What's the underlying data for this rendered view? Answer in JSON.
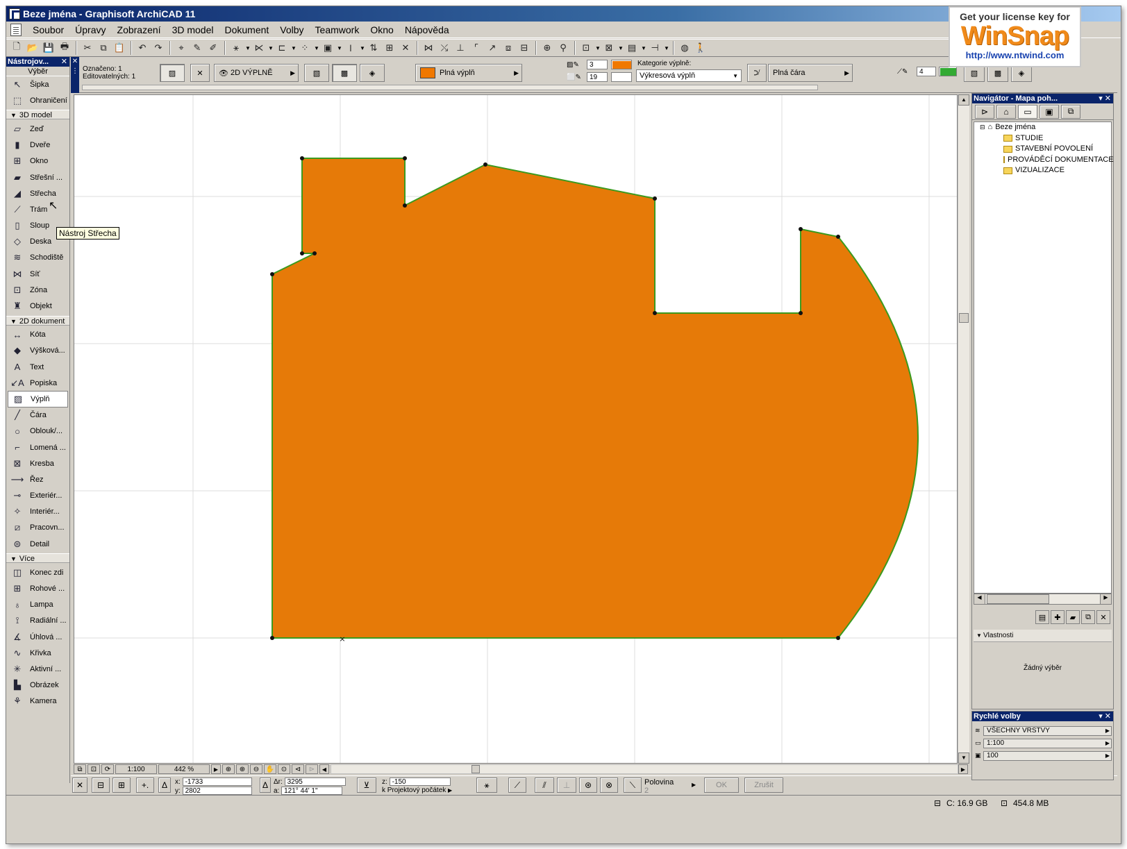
{
  "window": {
    "title": "Beze jména - Graphisoft ArchiCAD 11"
  },
  "menu": [
    "Soubor",
    "Úpravy",
    "Zobrazení",
    "3D model",
    "Dokument",
    "Volby",
    "Teamwork",
    "Okno",
    "Nápověda"
  ],
  "toolbox": {
    "title": "Nástrojov...",
    "subtitle": "Výběr",
    "selection_items": [
      {
        "label": "Šipka",
        "icon": "arrow-cursor-icon"
      },
      {
        "label": "Ohraničení",
        "icon": "marquee-icon"
      }
    ],
    "groups": [
      {
        "label": "3D model",
        "items": [
          {
            "label": "Zeď",
            "icon": "wall-icon"
          },
          {
            "label": "Dveře",
            "icon": "door-icon"
          },
          {
            "label": "Okno",
            "icon": "window-icon"
          },
          {
            "label": "Střešní ...",
            "icon": "skylight-icon"
          },
          {
            "label": "Střecha",
            "icon": "roof-icon"
          },
          {
            "label": "Trám",
            "icon": "beam-icon"
          },
          {
            "label": "Sloup",
            "icon": "column-icon"
          },
          {
            "label": "Deska",
            "icon": "slab-icon"
          },
          {
            "label": "Schodiště",
            "icon": "stair-icon"
          },
          {
            "label": "Síť",
            "icon": "mesh-icon"
          },
          {
            "label": "Zóna",
            "icon": "zone-icon"
          },
          {
            "label": "Objekt",
            "icon": "object-icon"
          }
        ]
      },
      {
        "label": "2D dokument",
        "items": [
          {
            "label": "Kóta",
            "icon": "dimension-icon"
          },
          {
            "label": "Výšková...",
            "icon": "level-dimension-icon"
          },
          {
            "label": "Text",
            "icon": "text-icon"
          },
          {
            "label": "Popiska",
            "icon": "label-icon"
          },
          {
            "label": "Výplň",
            "icon": "fill-icon",
            "active": true
          },
          {
            "label": "Čára",
            "icon": "line-icon"
          },
          {
            "label": "Oblouk/...",
            "icon": "arc-icon"
          },
          {
            "label": "Lomená ...",
            "icon": "polyline-icon"
          },
          {
            "label": "Kresba",
            "icon": "drawing-icon"
          },
          {
            "label": "Řez",
            "icon": "section-icon"
          },
          {
            "label": "Exteriér...",
            "icon": "elevation-icon"
          },
          {
            "label": "Interiér...",
            "icon": "interior-elevation-icon"
          },
          {
            "label": "Pracovn...",
            "icon": "worksheet-icon"
          },
          {
            "label": "Detail",
            "icon": "detail-icon"
          }
        ]
      },
      {
        "label": "Více",
        "items": [
          {
            "label": "Konec zdi",
            "icon": "wall-end-icon"
          },
          {
            "label": "Rohové ...",
            "icon": "corner-window-icon"
          },
          {
            "label": "Lampa",
            "icon": "lamp-icon"
          },
          {
            "label": "Radiální ...",
            "icon": "radial-dimension-icon"
          },
          {
            "label": "Úhlová ...",
            "icon": "angle-dimension-icon"
          },
          {
            "label": "Křivka",
            "icon": "curve-icon"
          },
          {
            "label": "Aktivní ...",
            "icon": "hotspot-icon"
          },
          {
            "label": "Obrázek",
            "icon": "picture-icon"
          },
          {
            "label": "Kamera",
            "icon": "camera-icon"
          }
        ]
      }
    ]
  },
  "tooltip": "Nástroj Střecha",
  "infobox": {
    "selected": "Označeno: 1",
    "editable": "Editovatelných: 1",
    "view_mode": "2D VÝPLNĚ",
    "fill_type": "Plná výplň",
    "pen1": "3",
    "pen2": "19",
    "category_label": "Kategorie výplně:",
    "category_value": "Výkresová výplň",
    "line_type": "Plná čára",
    "pen_weight": "4",
    "fill_color": "#f07800"
  },
  "drawing": {
    "fill_color": "#e67a08",
    "outline_color": "#3c9a1e"
  },
  "bottom_nav": {
    "scale": "1:100",
    "zoom": "442 %"
  },
  "coords": {
    "x_label": "x:",
    "x": "-1733",
    "y_label": "y:",
    "y": "2802",
    "dr_label": "Δr:",
    "dr": "3295",
    "a_label": "a:",
    "a": "121° 44' 1\"",
    "z_label": "z:",
    "z": "-150",
    "origin": "k Projektový počátek",
    "snap": "Polovina",
    "snap_value": "2",
    "ok": "OK",
    "cancel": "Zrušit"
  },
  "status": {
    "disk": "C: 16.9 GB",
    "memory": "454.8 MB"
  },
  "navigator": {
    "title": "Navigátor - Mapa poh...",
    "root": "Beze jména",
    "folders": [
      "STUDIE",
      "STAVEBNÍ POVOLENÍ",
      "PROVÁDĚCÍ DOKUMENTACE",
      "VIZUALIZACE"
    ],
    "properties_label": "Vlastnosti",
    "no_selection": "Žádný výběr"
  },
  "quick_options": {
    "title": "Rychlé volby",
    "layers": "VŠECHNY VRSTVY",
    "scale": "1:100",
    "pen_set": "100"
  },
  "watermark": {
    "line1": "Get your license key for",
    "brand": "WinSnap",
    "url": "http://www.ntwind.com"
  }
}
